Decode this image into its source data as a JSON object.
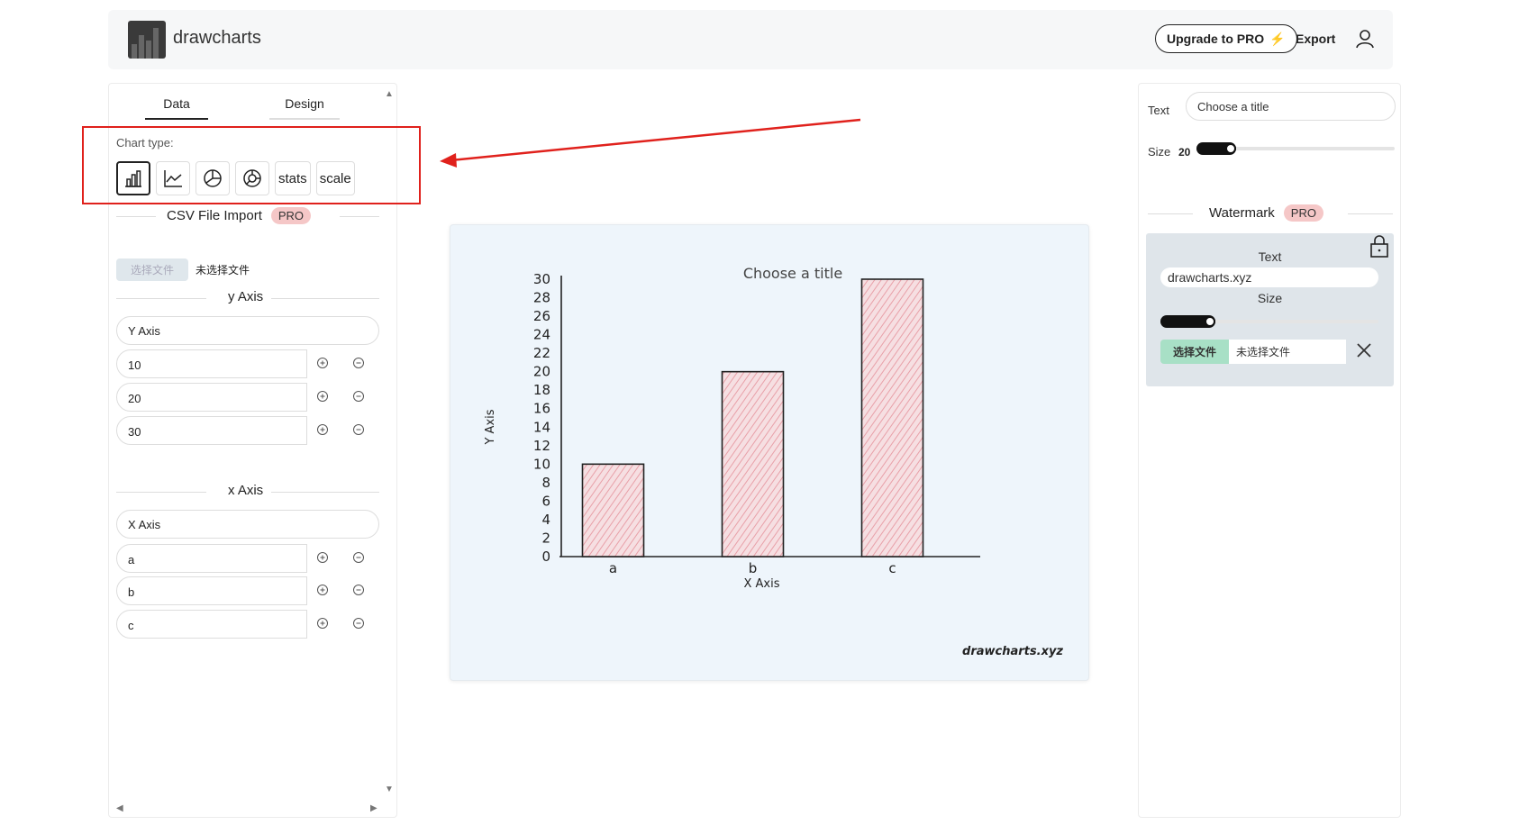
{
  "header": {
    "brand": "drawcharts",
    "upgrade_label": "Upgrade to PRO",
    "export_label": "Export"
  },
  "left_panel": {
    "tabs": [
      {
        "label": "Data",
        "active": true
      },
      {
        "label": "Design",
        "active": false
      }
    ],
    "chart_type_label": "Chart type:",
    "chart_types": [
      {
        "icon": "bar-chart-icon",
        "selected": true
      },
      {
        "icon": "line-chart-icon",
        "selected": false
      },
      {
        "icon": "pie-chart-icon",
        "selected": false
      },
      {
        "icon": "donut-chart-icon",
        "selected": false
      },
      {
        "label": "stats",
        "selected": false
      },
      {
        "label": "scale",
        "selected": false
      }
    ],
    "csv_section": "CSV File Import",
    "pro_badge": "PRO",
    "file_button": "选择文件",
    "file_status": "未选择文件",
    "y_axis_section": "y Axis",
    "y_axis_title": "Y Axis",
    "y_values": [
      "10",
      "20",
      "30"
    ],
    "x_axis_section": "x Axis",
    "x_axis_title": "X Axis",
    "x_values": [
      "a",
      "b",
      "c"
    ]
  },
  "chart_data": {
    "type": "bar",
    "title": "Choose a title",
    "xlabel": "X Axis",
    "ylabel": "Y Axis",
    "categories": [
      "a",
      "b",
      "c"
    ],
    "values": [
      10,
      20,
      30
    ],
    "ylim": [
      0,
      30
    ],
    "yticks": [
      "0",
      "2",
      "4",
      "6",
      "8",
      "10",
      "12",
      "14",
      "16",
      "18",
      "20",
      "22",
      "24",
      "26",
      "28",
      "30"
    ],
    "bar_color": "#e8a0a8",
    "watermark": "drawcharts.xyz"
  },
  "right_panel": {
    "text_label": "Text",
    "title_placeholder": "Choose a title",
    "size_label": "Size",
    "size_value": "20",
    "title_size_level": 0.2,
    "watermark_section": "Watermark",
    "pro_badge": "PRO",
    "wm_text_label": "Text",
    "wm_text_value": "drawcharts.xyz",
    "wm_size_label": "Size",
    "wm_size_level": 0.25,
    "wm_file_button": "选择文件",
    "wm_file_status": "未选择文件"
  },
  "colors": {
    "accent_red": "#e0211c",
    "pro_badge": "#f5c7c7",
    "chart_bg": "#eef5fb"
  }
}
